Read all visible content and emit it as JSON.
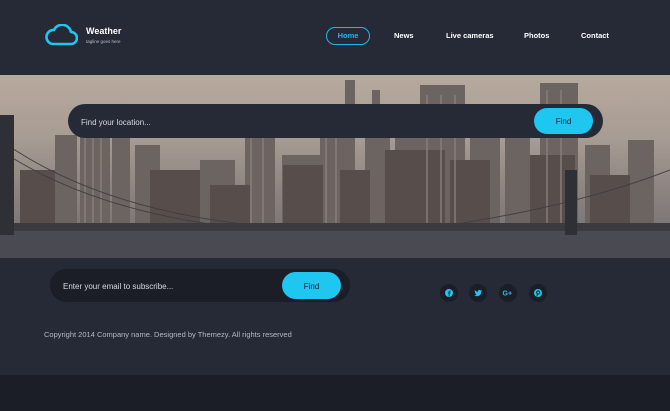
{
  "brand": {
    "name": "Weather",
    "tagline": "tagline goes here"
  },
  "nav": {
    "items": [
      {
        "label": "Home",
        "active": true
      },
      {
        "label": "News",
        "active": false
      },
      {
        "label": "Live cameras",
        "active": false
      },
      {
        "label": "Photos",
        "active": false
      },
      {
        "label": "Contact",
        "active": false
      }
    ]
  },
  "search": {
    "placeholder": "Find your location...",
    "button_label": "Find"
  },
  "subscribe": {
    "placeholder": "Enter your email to subscribe...",
    "button_label": "Find"
  },
  "social": [
    {
      "icon": "facebook-icon",
      "glyph": "f"
    },
    {
      "icon": "twitter-icon",
      "glyph": "t"
    },
    {
      "icon": "google-plus-icon",
      "glyph": "G+"
    },
    {
      "icon": "pinterest-icon",
      "glyph": "p"
    }
  ],
  "copyright": "Copyright 2014 Company name. Designed by Themezy. All rights reserved",
  "colors": {
    "accent": "#1fc6f0",
    "header_bg": "#262936",
    "page_bg": "#1b1e27"
  }
}
